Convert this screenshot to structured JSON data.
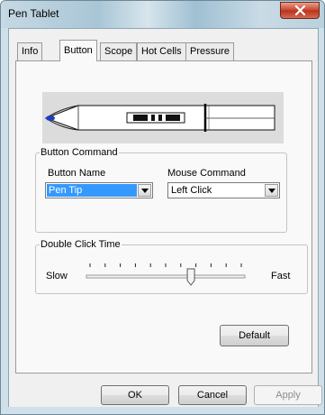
{
  "window": {
    "title": "Pen Tablet"
  },
  "tabs": [
    {
      "label": "Info",
      "active": false
    },
    {
      "label": "Button",
      "active": true
    },
    {
      "label": "Scope",
      "active": false
    },
    {
      "label": "Hot Cells",
      "active": false
    },
    {
      "label": "Pressure",
      "active": false
    }
  ],
  "button_command": {
    "legend": "Button Command",
    "button_name_label": "Button Name",
    "button_name_value": "Pen Tip",
    "mouse_command_label": "Mouse Command",
    "mouse_command_value": "Left Click"
  },
  "double_click": {
    "legend": "Double Click Time",
    "slow_label": "Slow",
    "fast_label": "Fast",
    "slider_level": 0.667
  },
  "buttons": {
    "default_label": "Default",
    "ok_label": "OK",
    "cancel_label": "Cancel",
    "apply_label": "Apply",
    "apply_enabled": false
  },
  "colors": {
    "selection": "#3399ff",
    "close_button": "#c7432b",
    "pen_tip": "#1f3fbf"
  },
  "icons": {
    "close": "close-icon",
    "dropdown": "chevron-down-icon",
    "pen": "pen-illustration"
  }
}
